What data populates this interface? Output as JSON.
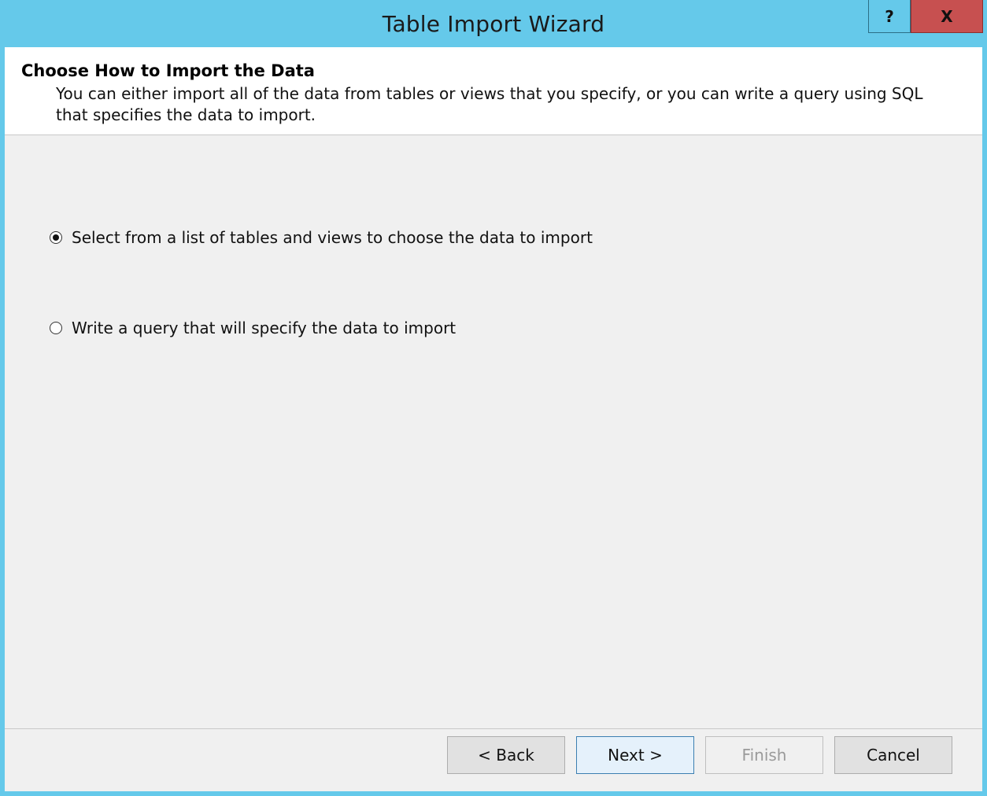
{
  "window": {
    "title": "Table Import Wizard",
    "help_label": "?",
    "close_label": "X"
  },
  "header": {
    "title": "Choose How to Import the Data",
    "description": "You can either import all of the data from tables or views that you specify, or you can write a query using SQL that specifies the data to import."
  },
  "options": [
    {
      "label": "Select from a list of tables and views to choose the data to import",
      "selected": true
    },
    {
      "label": "Write a query that will specify the data to import",
      "selected": false
    }
  ],
  "buttons": {
    "back": "< Back",
    "next": "Next >",
    "finish": "Finish",
    "cancel": "Cancel"
  },
  "colors": {
    "title_bar": "#65c9ea",
    "close_button": "#c75050",
    "panel_background": "#f0f0f0"
  }
}
